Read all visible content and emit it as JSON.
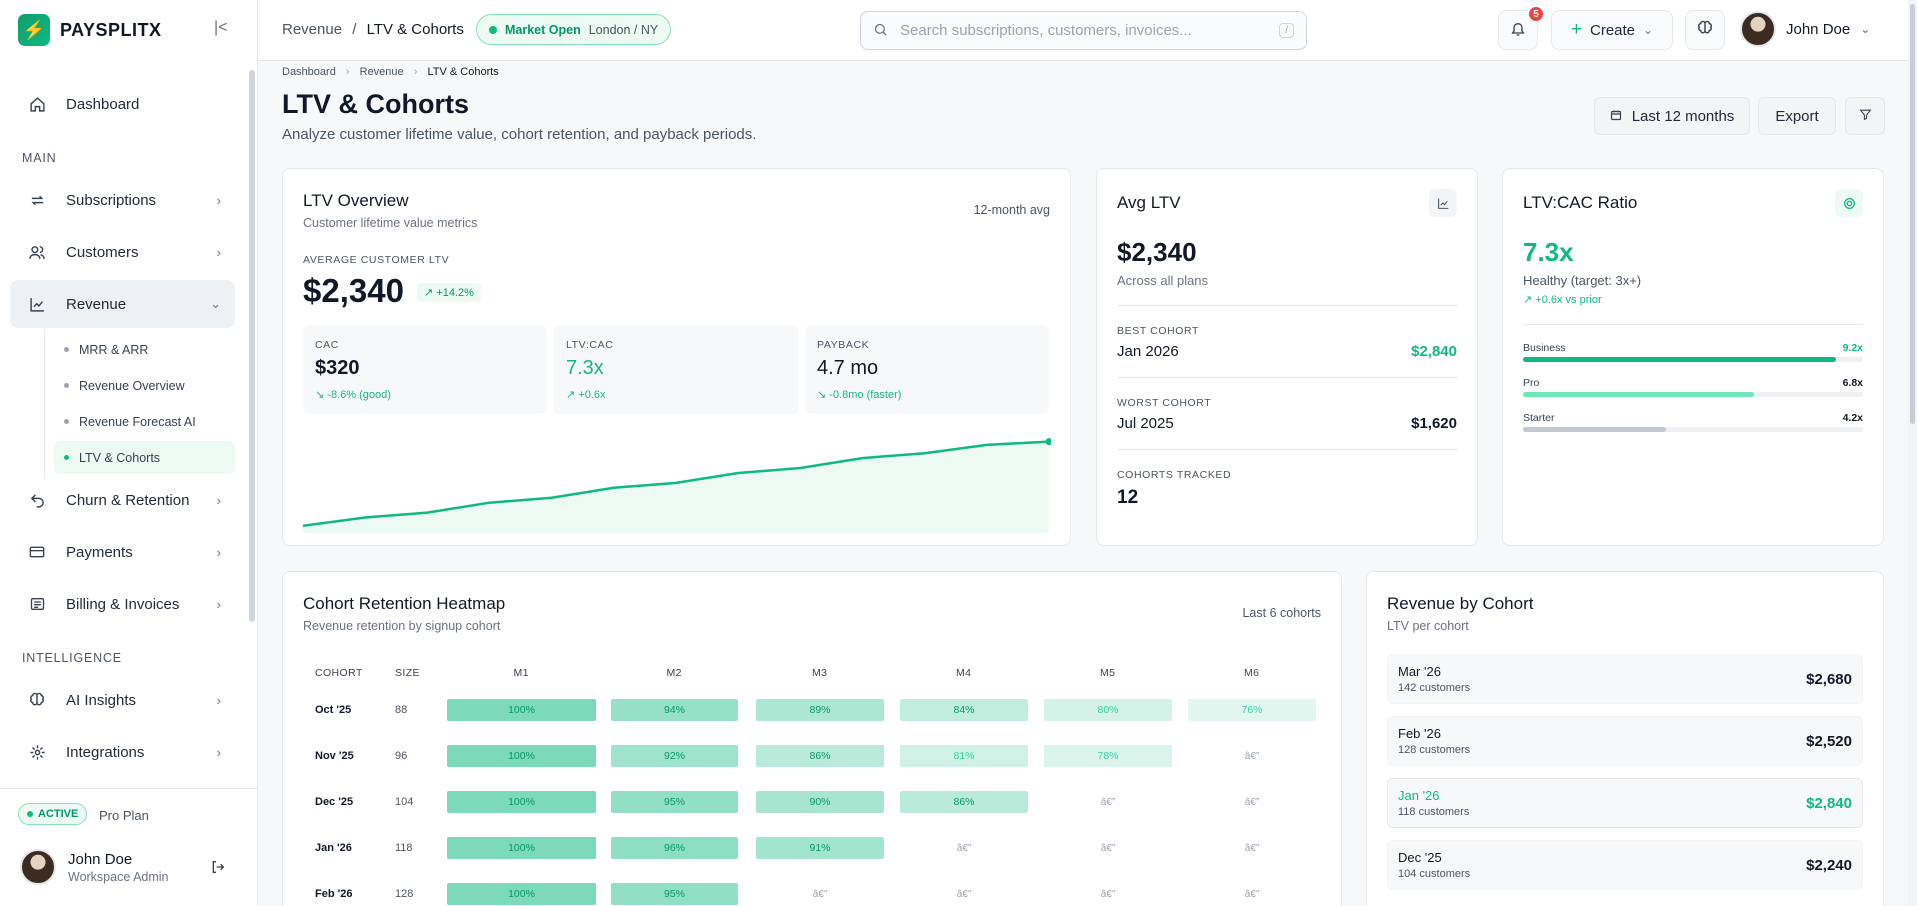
{
  "brand": {
    "name": "PAYSPLITX"
  },
  "sidebar": {
    "items": [
      {
        "label": "Dashboard"
      },
      {
        "label": "Subscriptions"
      },
      {
        "label": "Customers"
      },
      {
        "label": "Revenue"
      },
      {
        "label": "Churn & Retention"
      },
      {
        "label": "Payments"
      },
      {
        "label": "Billing & Invoices"
      },
      {
        "label": "AI Insights"
      },
      {
        "label": "Integrations"
      }
    ],
    "sections": {
      "main": "MAIN",
      "intelligence": "INTELLIGENCE"
    },
    "revenue_sub": [
      "MRR & ARR",
      "Revenue Overview",
      "Revenue Forecast AI",
      "LTV & Cohorts"
    ],
    "footer": {
      "badge": "ACTIVE",
      "plan": "Pro Plan",
      "user_name": "John Doe",
      "user_role": "Workspace Admin"
    }
  },
  "topbar": {
    "crumb_parent": "Revenue",
    "crumb_sep": "/",
    "crumb_current": "LTV & Cohorts",
    "market_status": "Market Open",
    "market_locations": "London / NY",
    "search_placeholder": "Search subscriptions, customers, invoices...",
    "search_shortcut": "/",
    "notification_count": "5",
    "create_label": "Create",
    "user_name": "John Doe"
  },
  "page": {
    "breadcrumb": [
      "Dashboard",
      "Revenue",
      "LTV & Cohorts"
    ],
    "title": "LTV & Cohorts",
    "subtitle": "Analyze customer lifetime value, cohort retention, and payback periods.",
    "range_label": "Last 12 months",
    "export_label": "Export"
  },
  "ltv_overview": {
    "title": "LTV Overview",
    "subtitle": "Customer lifetime value metrics",
    "tag": "12-month avg",
    "avg_label": "AVERAGE CUSTOMER LTV",
    "avg_value": "$2,340",
    "avg_change": "+14.2%",
    "metrics": [
      {
        "label": "CAC",
        "value": "$320",
        "change": "-8.6% (good)"
      },
      {
        "label": "LTV:CAC",
        "value": "7.3x",
        "change": "+0.6x"
      },
      {
        "label": "PAYBACK",
        "value": "4.7 mo",
        "change": "-0.8mo (faster)"
      }
    ],
    "trend": [
      1830,
      1880,
      1910,
      1970,
      2000,
      2060,
      2090,
      2150,
      2180,
      2240,
      2270,
      2320,
      2340
    ]
  },
  "avg_ltv": {
    "title": "Avg LTV",
    "value": "$2,340",
    "note": "Across all plans",
    "best_label": "BEST COHORT",
    "best_name": "Jan 2026",
    "best_value": "$2,840",
    "worst_label": "WORST COHORT",
    "worst_name": "Jul 2025",
    "worst_value": "$1,620",
    "tracked_label": "COHORTS TRACKED",
    "tracked_value": "12"
  },
  "ratio": {
    "title": "LTV:CAC Ratio",
    "value": "7.3x",
    "note": "Healthy (target: 3x+)",
    "change": "+0.6x vs prior",
    "plans": [
      {
        "name": "Business",
        "value": "9.2x",
        "level": 0.92,
        "color": "#10b981"
      },
      {
        "name": "Pro",
        "value": "6.8x",
        "level": 0.68,
        "color": "#6ee7b7"
      },
      {
        "name": "Starter",
        "value": "4.2x",
        "level": 0.42,
        "color": "#c4c8cf"
      }
    ]
  },
  "heatmap": {
    "title": "Cohort Retention Heatmap",
    "subtitle": "Revenue retention by signup cohort",
    "tag": "Last 6 cohorts",
    "col_cohort": "COHORT",
    "col_size": "SIZE",
    "months": [
      "M1",
      "M2",
      "M3",
      "M4",
      "M5",
      "M6"
    ],
    "empty_glyph": "â€”",
    "rows": [
      {
        "cohort": "Oct '25",
        "size": "88",
        "values": [
          "100%",
          "94%",
          "89%",
          "84%",
          "80%",
          "76%"
        ]
      },
      {
        "cohort": "Nov '25",
        "size": "96",
        "values": [
          "100%",
          "92%",
          "86%",
          "81%",
          "78%",
          null
        ]
      },
      {
        "cohort": "Dec '25",
        "size": "104",
        "values": [
          "100%",
          "95%",
          "90%",
          "86%",
          null,
          null
        ]
      },
      {
        "cohort": "Jan '26",
        "size": "118",
        "values": [
          "100%",
          "96%",
          "91%",
          null,
          null,
          null
        ]
      },
      {
        "cohort": "Feb '26",
        "size": "128",
        "values": [
          "100%",
          "95%",
          null,
          null,
          null,
          null
        ]
      }
    ]
  },
  "rev_cohort": {
    "title": "Revenue by Cohort",
    "subtitle": "LTV per cohort",
    "rows": [
      {
        "name": "Mar '26",
        "customers": "142 customers",
        "value": "$2,680"
      },
      {
        "name": "Feb '26",
        "customers": "128 customers",
        "value": "$2,520"
      },
      {
        "name": "Jan '26",
        "customers": "118 customers",
        "value": "$2,840"
      },
      {
        "name": "Dec '25",
        "customers": "104 customers",
        "value": "$2,240"
      }
    ]
  },
  "colors": {
    "accent": "#10b981",
    "accent_dark": "#059669"
  }
}
